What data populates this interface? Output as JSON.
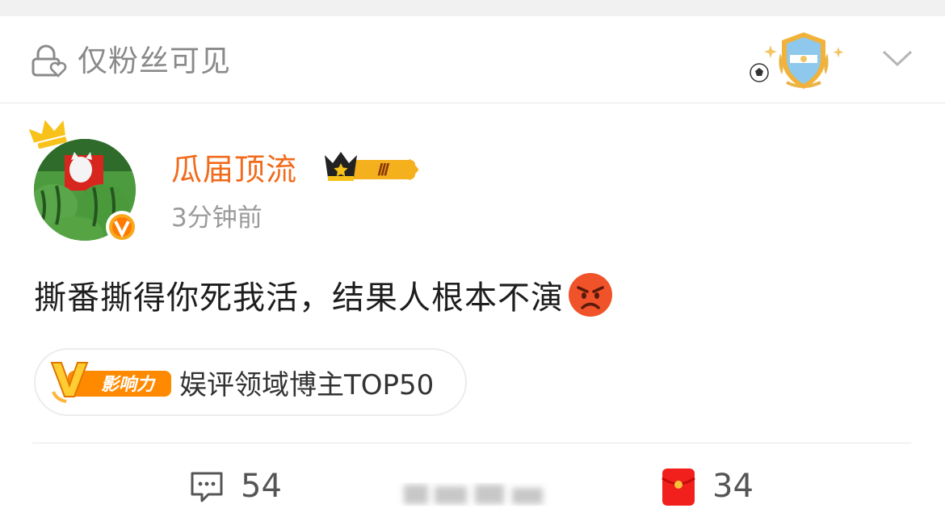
{
  "visibility": {
    "label": "仅粉丝可见",
    "lock_icon": "lock-heart-icon",
    "emblem_icon": "argentina-shield-badge-icon",
    "menu_icon": "chevron-down-icon"
  },
  "post": {
    "author": {
      "name": "瓜届顶流",
      "name_color": "#f26a1b",
      "avatar_icon": "watermelon-cat-avatar",
      "crown_icon": "crown-icon",
      "verified_icon": "verified-v-icon",
      "vip_level": "Ⅲ"
    },
    "time": "3分钟前",
    "text": "撕番撕得你死我活，结果人根本不演",
    "emoji": "angry-face-icon",
    "influence": {
      "badge_letter": "V",
      "badge_label": "影响力",
      "label": "娱评领域博主TOP50"
    }
  },
  "actions": {
    "comments": {
      "icon": "comment-icon",
      "count": "54"
    },
    "red_packet": {
      "icon": "red-packet-icon",
      "count": "34"
    }
  },
  "colors": {
    "accent": "#f26a1b",
    "muted": "#9a9a9a",
    "gold": "#f5b01e"
  }
}
